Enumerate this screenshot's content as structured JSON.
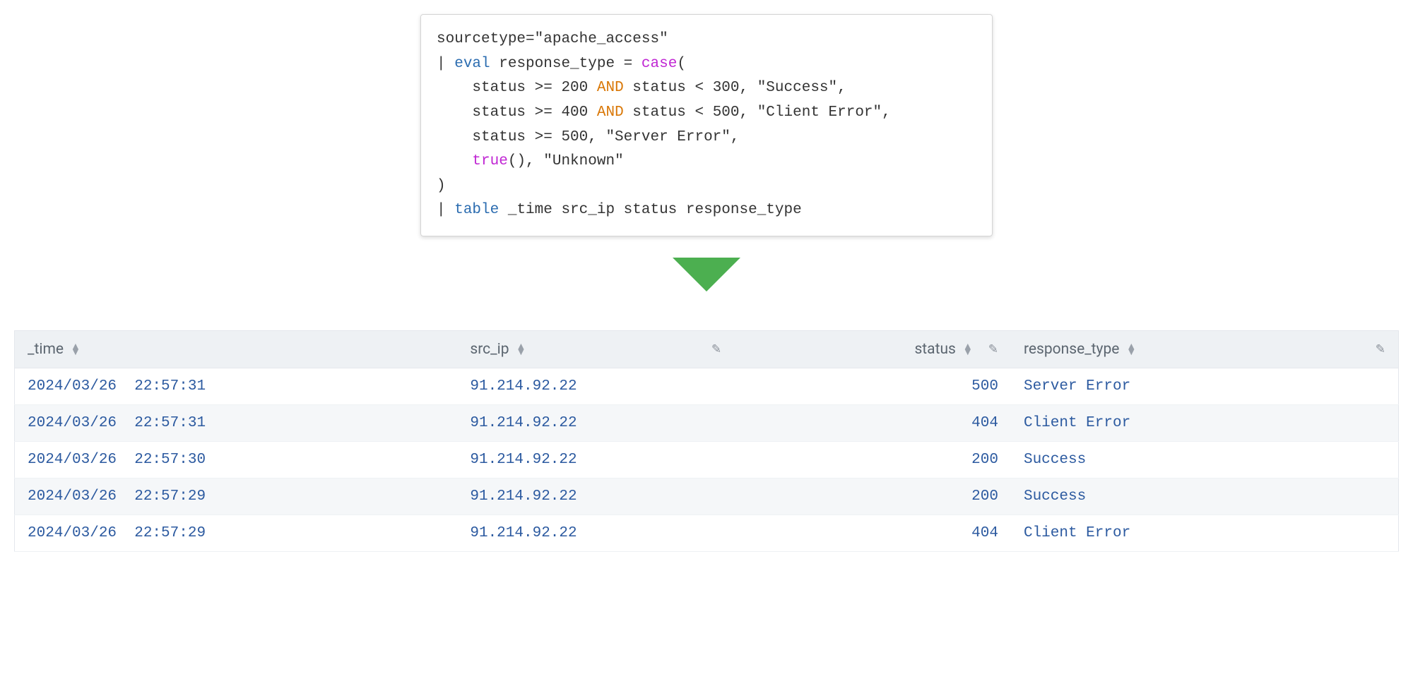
{
  "query": {
    "line1": {
      "key_label": "sourcetype",
      "equals": "=",
      "value": "\"apache_access\""
    },
    "line2": {
      "pipe": "| ",
      "cmd": "eval",
      "mid": " response_type = ",
      "fn": "case",
      "open": "("
    },
    "line3": {
      "indent": "    ",
      "a": "status >= 200 ",
      "op": "AND",
      "b": " status < 300, \"Success\","
    },
    "line4": {
      "indent": "    ",
      "a": "status >= 400 ",
      "op": "AND",
      "b": " status < 500, \"Client Error\","
    },
    "line5": {
      "indent": "    ",
      "text": "status >= 500, \"Server Error\","
    },
    "line6": {
      "indent": "    ",
      "fn": "true",
      "rest": "(), \"Unknown\""
    },
    "line7": {
      "text": ")"
    },
    "line8": {
      "pipe": "| ",
      "cmd": "table",
      "rest": " _time src_ip status response_type"
    }
  },
  "table": {
    "columns": {
      "time": {
        "label": "_time"
      },
      "src_ip": {
        "label": "src_ip"
      },
      "status": {
        "label": "status"
      },
      "resp": {
        "label": "response_type"
      }
    },
    "rows": [
      {
        "time": "2024/03/26  22:57:31",
        "src_ip": "91.214.92.22",
        "status": "500",
        "resp": "Server Error"
      },
      {
        "time": "2024/03/26  22:57:31",
        "src_ip": "91.214.92.22",
        "status": "404",
        "resp": "Client Error"
      },
      {
        "time": "2024/03/26  22:57:30",
        "src_ip": "91.214.92.22",
        "status": "200",
        "resp": "Success"
      },
      {
        "time": "2024/03/26  22:57:29",
        "src_ip": "91.214.92.22",
        "status": "200",
        "resp": "Success"
      },
      {
        "time": "2024/03/26  22:57:29",
        "src_ip": "91.214.92.22",
        "status": "404",
        "resp": "Client Error"
      }
    ]
  }
}
